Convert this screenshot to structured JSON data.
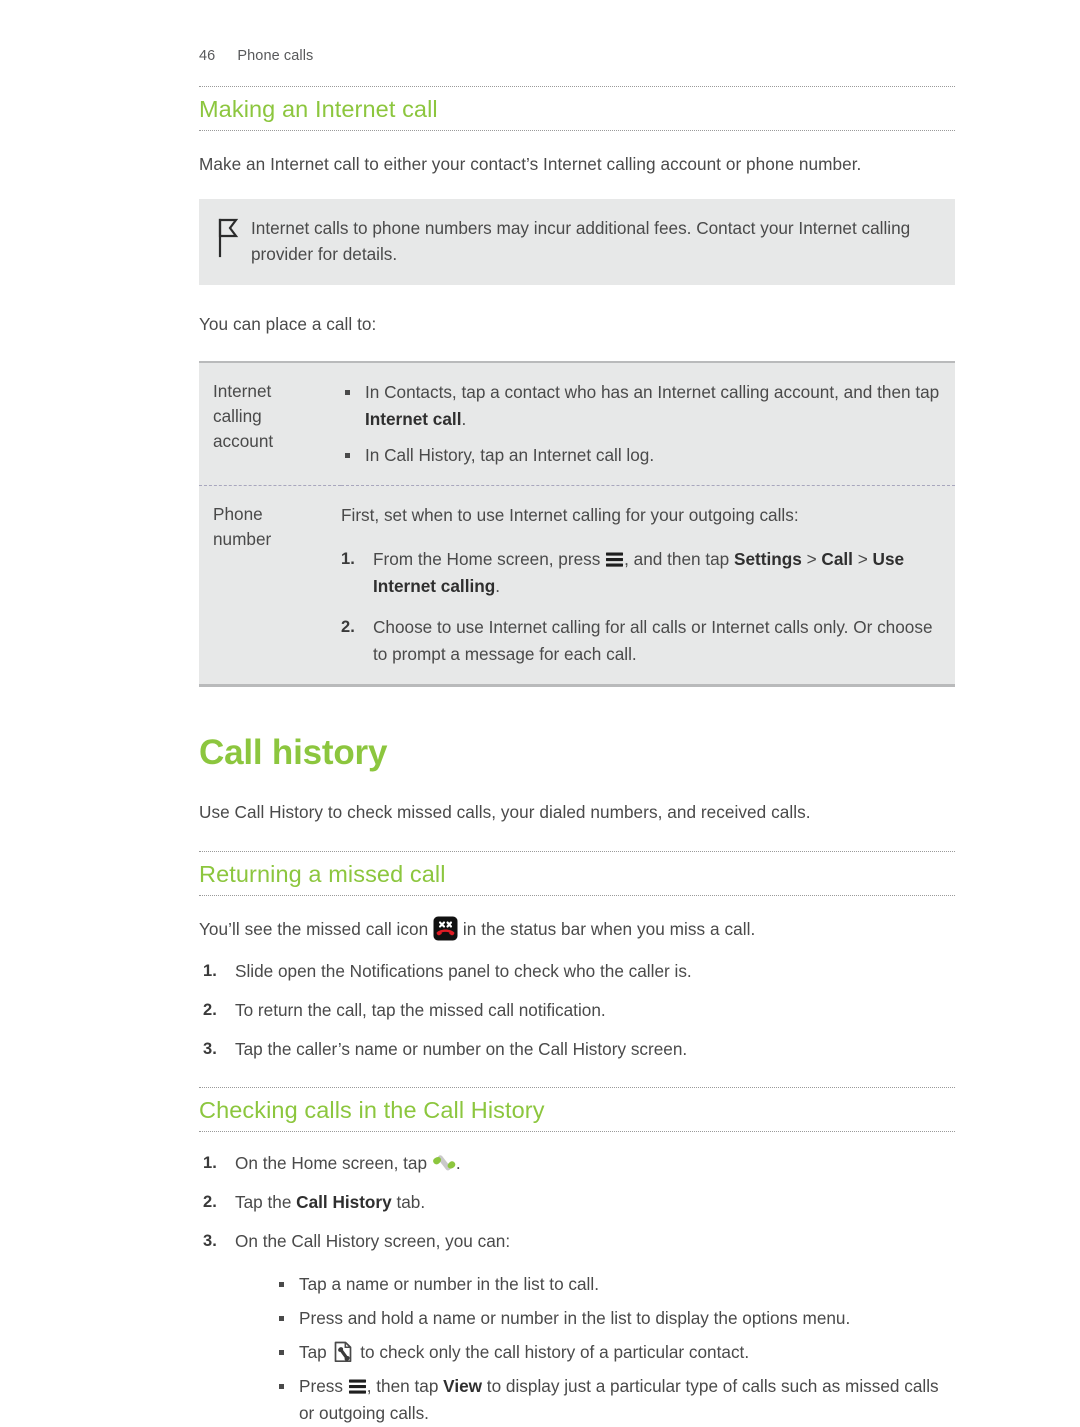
{
  "header": {
    "page_number": "46",
    "section_title": "Phone calls"
  },
  "colors": {
    "heading_green": "#8cc63e",
    "body_text": "#4a4a4a",
    "note_background": "#e7e8e8",
    "table_background": "#e7e8e8",
    "missed_call_red": "#e01b24",
    "phone_icon_green": "#8cc63e"
  },
  "section_internet_call": {
    "heading": "Making an Internet call",
    "intro": "Make an Internet call to either your contact’s Internet calling account or phone number.",
    "note": {
      "icon": "flag-icon",
      "text": "Internet calls to phone numbers may incur additional fees. Contact your Internet calling provider for details."
    },
    "lead_in": "You can place a call to:",
    "table": {
      "rows": [
        {
          "key": "Internet calling account",
          "key_lines": [
            "Internet",
            "calling",
            "account"
          ],
          "bullets": [
            {
              "parts": [
                {
                  "text": "In Contacts, tap a contact who has an Internet calling account, and then tap ",
                  "bold": false
                },
                {
                  "text": "Internet call",
                  "bold": true
                },
                {
                  "text": ".",
                  "bold": false
                }
              ]
            },
            {
              "parts": [
                {
                  "text": "In Call History, tap an Internet call log.",
                  "bold": false
                }
              ]
            }
          ]
        },
        {
          "key": "Phone number",
          "key_lines": [
            "Phone",
            "number"
          ],
          "lead_in": "First, set when to use Internet calling for your outgoing calls:",
          "steps": [
            {
              "parts": [
                {
                  "text": "From the Home screen, press ",
                  "bold": false
                },
                {
                  "icon": "menu-icon"
                },
                {
                  "text": ", and then tap ",
                  "bold": false
                },
                {
                  "text": "Settings",
                  "bold": true
                },
                {
                  "text": " > ",
                  "bold": false
                },
                {
                  "text": "Call",
                  "bold": true
                },
                {
                  "text": " > ",
                  "bold": false
                },
                {
                  "text": "Use Internet calling",
                  "bold": true
                },
                {
                  "text": ".",
                  "bold": false
                }
              ]
            },
            {
              "parts": [
                {
                  "text": "Choose to use Internet calling for all calls or Internet calls only. Or choose to prompt a message for each call.",
                  "bold": false
                }
              ]
            }
          ]
        }
      ]
    }
  },
  "section_call_history": {
    "heading": "Call history",
    "intro": "Use Call History to check missed calls, your dialed numbers, and received calls.",
    "returning_missed_call": {
      "heading": "Returning a missed call",
      "intro_parts": [
        {
          "text": "You’ll see the missed call icon ",
          "bold": false
        },
        {
          "icon": "missed-call-icon"
        },
        {
          "text": " in the status bar when you miss a call.",
          "bold": false
        }
      ],
      "steps": [
        "Slide open the Notifications panel to check who the caller is.",
        "To return the call, tap the missed call notification.",
        "Tap the caller’s name or number on the Call History screen."
      ]
    },
    "checking_calls": {
      "heading": "Checking calls in the Call History",
      "steps": [
        {
          "parts": [
            {
              "text": "On the Home screen, tap ",
              "bold": false
            },
            {
              "icon": "phone-handset-icon"
            },
            {
              "text": ".",
              "bold": false
            }
          ]
        },
        {
          "parts": [
            {
              "text": "Tap the ",
              "bold": false
            },
            {
              "text": "Call History",
              "bold": true
            },
            {
              "text": " tab.",
              "bold": false
            }
          ]
        },
        {
          "parts": [
            {
              "text": "On the Call History screen, you can:",
              "bold": false
            }
          ]
        }
      ],
      "bullets": [
        {
          "parts": [
            {
              "text": "Tap a name or number in the list to call.",
              "bold": false
            }
          ]
        },
        {
          "parts": [
            {
              "text": "Press and hold a name or number in the list to display the options menu.",
              "bold": false
            }
          ]
        },
        {
          "parts": [
            {
              "text": "Tap ",
              "bold": false
            },
            {
              "icon": "contact-card-icon"
            },
            {
              "text": " to check only the call history of a particular contact.",
              "bold": false
            }
          ]
        },
        {
          "parts": [
            {
              "text": "Press ",
              "bold": false
            },
            {
              "icon": "menu-icon"
            },
            {
              "text": ", then tap ",
              "bold": false
            },
            {
              "text": "View",
              "bold": true
            },
            {
              "text": " to display just a particular type of calls such as missed calls or outgoing calls.",
              "bold": false
            }
          ]
        }
      ]
    }
  }
}
